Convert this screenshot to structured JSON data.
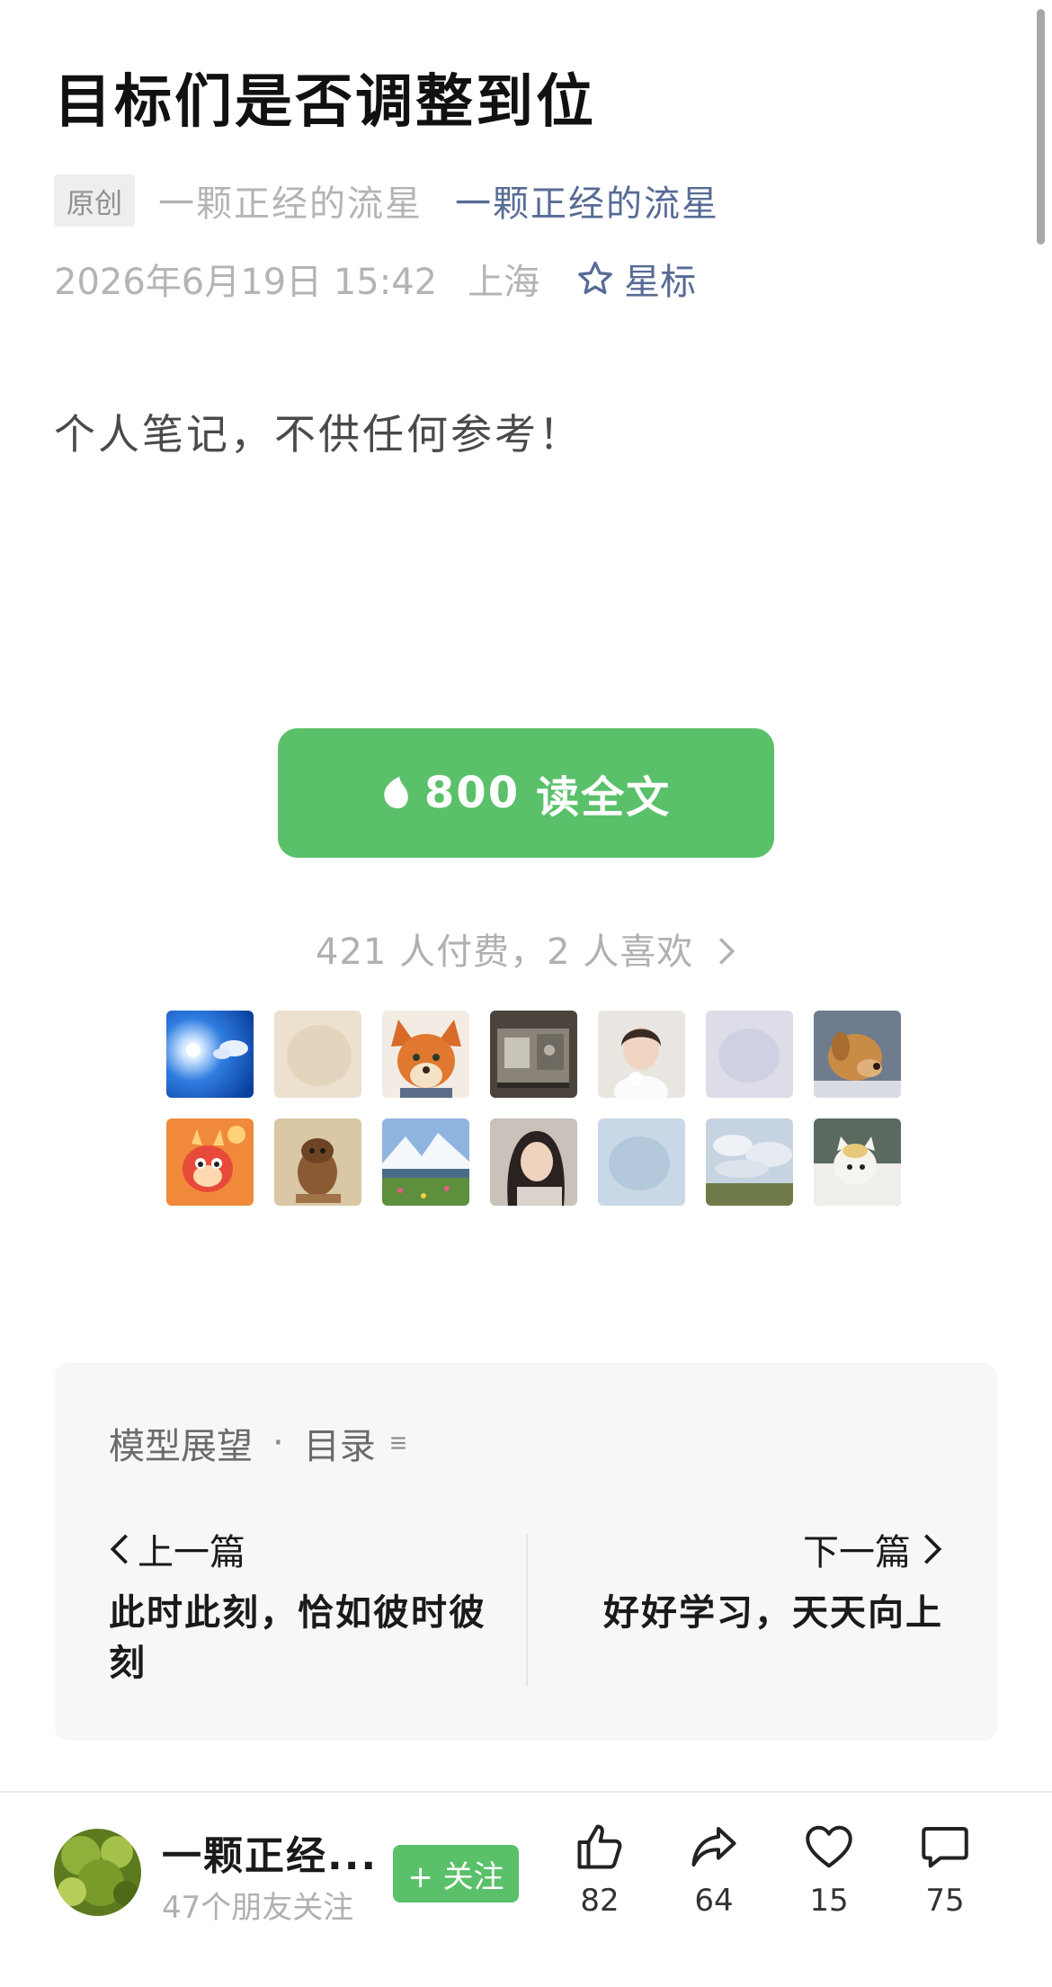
{
  "article": {
    "title": "目标们是否调整到位",
    "original_tag": "原创",
    "author_name_gray": "一颗正经的流星",
    "author_link": "一颗正经的流星",
    "date": "2026年6月19日 15:42",
    "location": "上海",
    "star_label": "星标",
    "body": "个人笔记，不供任何参考！"
  },
  "paywall": {
    "price": "800",
    "read_label": "读全文",
    "stats_text": "421 人付费，2 人喜欢"
  },
  "avatar_icons": [
    "sky-sun-avatar",
    "blurred-beige-avatar",
    "fox-avatar",
    "machine-avatar",
    "woman-portrait-avatar",
    "blurred-lavender-avatar",
    "golden-dog-avatar",
    "dragon-avatar",
    "figurine-avatar",
    "mountain-lake-avatar",
    "girl-portrait-avatar",
    "blurred-blue-avatar",
    "cloudy-field-avatar",
    "white-cat-avatar"
  ],
  "toc": {
    "series_name": "模型展望",
    "toc_label": "目录",
    "prev_label": "上一篇",
    "prev_title": "此时此刻，恰如彼时彼刻",
    "next_label": "下一篇",
    "next_title": "好好学习，天天向上"
  },
  "bottom_bar": {
    "name": "一颗正经...",
    "followers": "47个朋友关注",
    "follow_label": "+ 关注",
    "like_count": "82",
    "share_count": "64",
    "heart_count": "15",
    "comment_count": "75"
  },
  "colors": {
    "accent_green": "#5ac06a",
    "link_blue": "#576b95",
    "muted_gray": "#b4b4b4"
  }
}
